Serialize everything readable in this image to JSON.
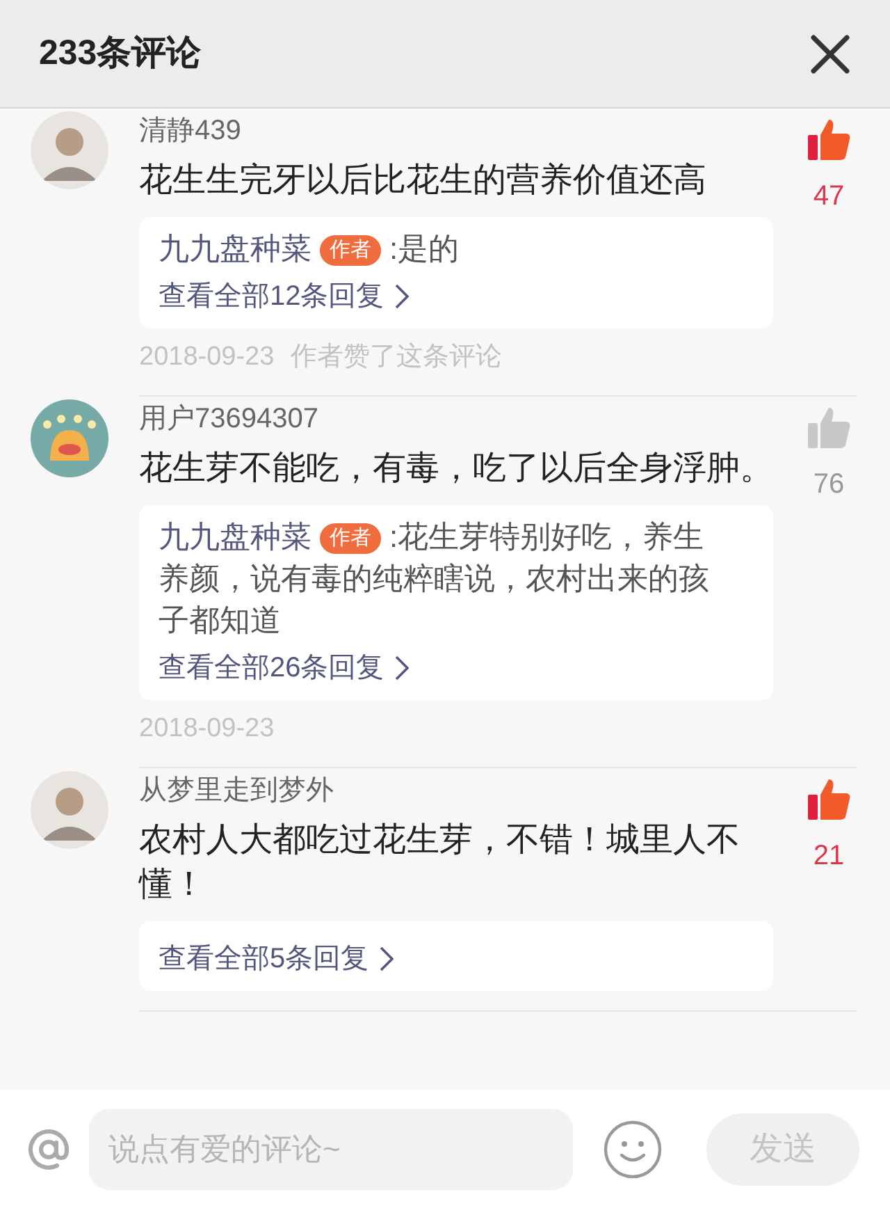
{
  "header": {
    "title": "233条评论"
  },
  "comments": [
    {
      "user": "清静439",
      "avatar": {
        "kind": "photo"
      },
      "text": "花生生完牙以后比花生的营养价值还高",
      "liked": true,
      "likes": "47",
      "reply": {
        "author": "九九盘种菜",
        "badge": "作者",
        "text": ":是的"
      },
      "view_replies": "查看全部12条回复",
      "date": "2018-09-23",
      "note": "作者赞了这条评论"
    },
    {
      "user": "用户73694307",
      "avatar": {
        "kind": "cartoon"
      },
      "text": "花生芽不能吃，有毒，吃了以后全身浮肿。",
      "liked": false,
      "likes": "76",
      "reply": {
        "author": "九九盘种菜",
        "badge": "作者",
        "text": ":花生芽特别好吃，养生养颜，说有毒的纯粹瞎说，农村出来的孩子都知道"
      },
      "view_replies": "查看全部26条回复",
      "date": "2018-09-23"
    },
    {
      "user": "从梦里走到梦外",
      "avatar": {
        "kind": "photo"
      },
      "text": "农村人大都吃过花生芽，不错！城里人不懂！",
      "liked": true,
      "likes": "21",
      "view_replies": "查看全部5条回复"
    }
  ],
  "composer": {
    "placeholder": "说点有爱的评论~",
    "send": "发送",
    "send_disabled": true
  }
}
